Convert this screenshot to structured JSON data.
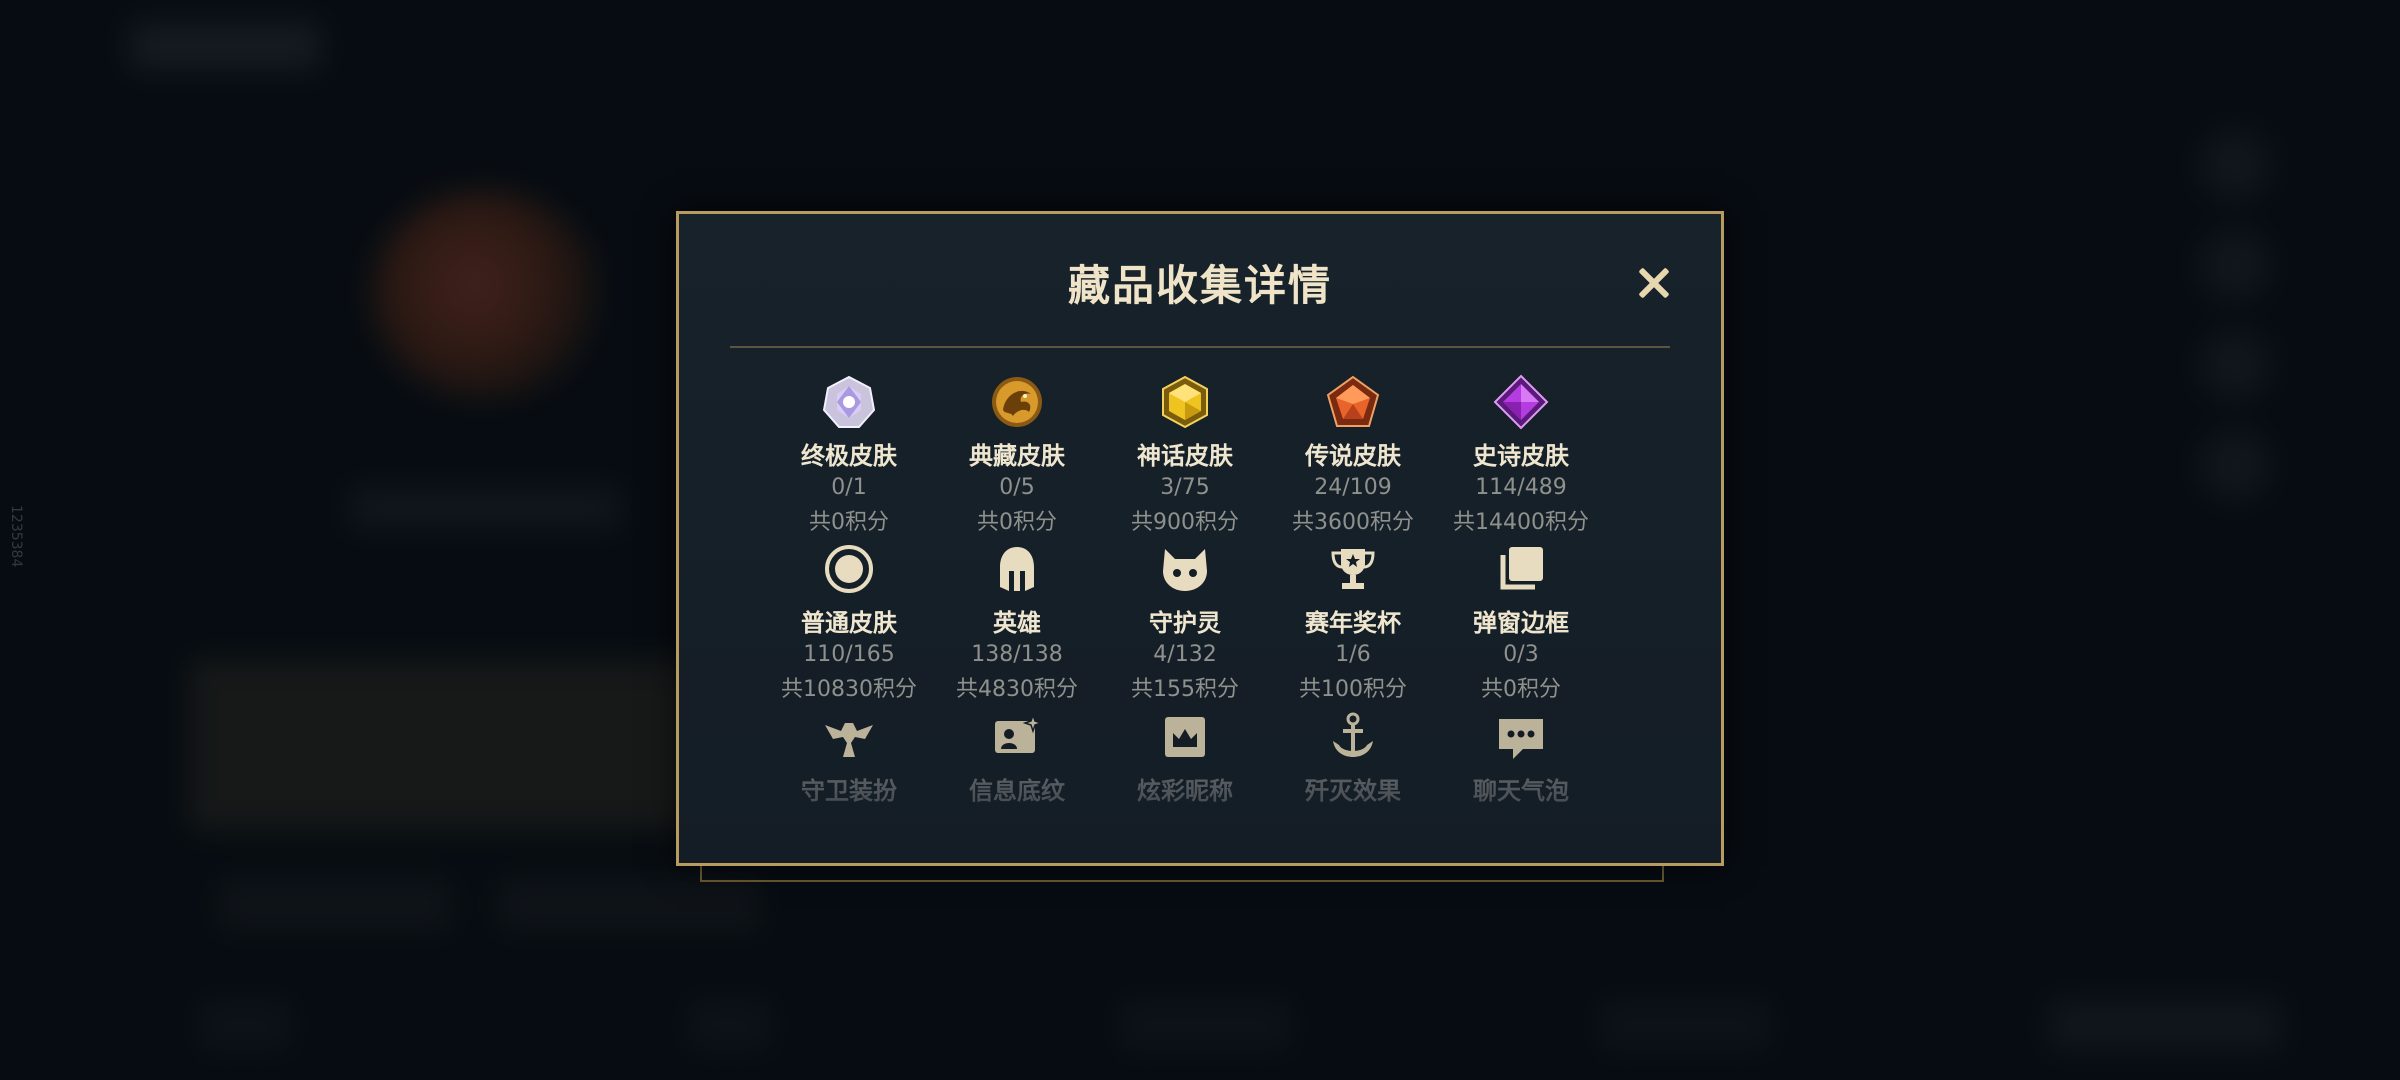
{
  "background": {
    "side_id": "1235384"
  },
  "modal": {
    "title": "藏品收集详情",
    "close_label": "×",
    "rows": [
      [
        {
          "icon": "ultimate-skin-gem-icon",
          "label": "终极皮肤",
          "count": "0/1",
          "points": "共0积分"
        },
        {
          "icon": "treasure-skin-dragon-icon",
          "label": "典藏皮肤",
          "count": "0/5",
          "points": "共0积分"
        },
        {
          "icon": "mythic-skin-gem-icon",
          "label": "神话皮肤",
          "count": "3/75",
          "points": "共900积分"
        },
        {
          "icon": "legendary-skin-gem-icon",
          "label": "传说皮肤",
          "count": "24/109",
          "points": "共3600积分"
        },
        {
          "icon": "epic-skin-gem-icon",
          "label": "史诗皮肤",
          "count": "114/489",
          "points": "共14400积分"
        }
      ],
      [
        {
          "icon": "common-skin-ring-icon",
          "label": "普通皮肤",
          "count": "110/165",
          "points": "共10830积分"
        },
        {
          "icon": "hero-helmet-icon",
          "label": "英雄",
          "count": "138/138",
          "points": "共4830积分"
        },
        {
          "icon": "guardian-pet-icon",
          "label": "守护灵",
          "count": "4/132",
          "points": "共155积分"
        },
        {
          "icon": "season-trophy-icon",
          "label": "赛年奖杯",
          "count": "1/6",
          "points": "共100积分"
        },
        {
          "icon": "popup-frame-icon",
          "label": "弹窗边框",
          "count": "0/3",
          "points": "共0积分"
        }
      ],
      [
        {
          "icon": "ward-skin-icon",
          "label": "守卫装扮"
        },
        {
          "icon": "info-card-icon",
          "label": "信息底纹"
        },
        {
          "icon": "fancy-nickname-icon",
          "label": "炫彩昵称"
        },
        {
          "icon": "kill-effect-icon",
          "label": "歼灭效果"
        },
        {
          "icon": "chat-bubble-icon",
          "label": "聊天气泡"
        }
      ]
    ]
  }
}
